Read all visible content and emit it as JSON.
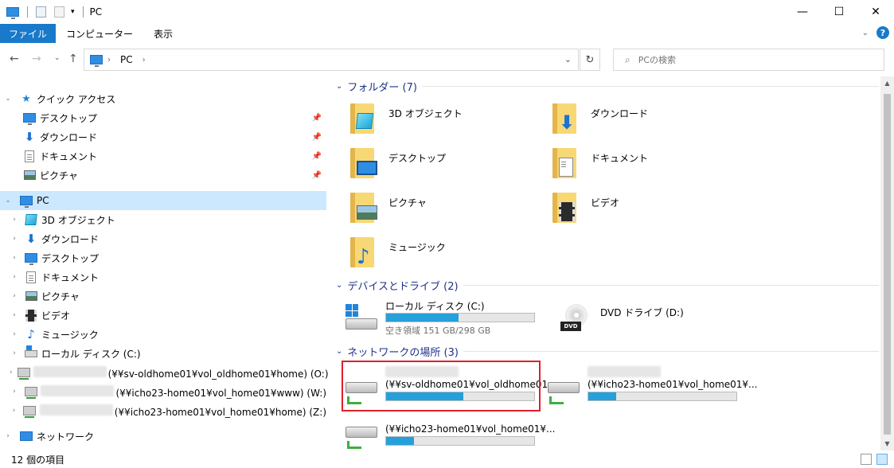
{
  "window": {
    "title": "PC",
    "buttons": {
      "minimize": "—",
      "maximize": "☐",
      "close": "✕"
    }
  },
  "ribbon": {
    "tabs": [
      "ファイル",
      "コンピューター",
      "表示"
    ],
    "help": "?"
  },
  "address": {
    "crumbs": [
      "PC"
    ],
    "search_placeholder": "PCの検索"
  },
  "nav": {
    "quick_access": {
      "label": "クイック アクセス",
      "items": [
        {
          "label": "デスクトップ",
          "icon": "desktop-icon"
        },
        {
          "label": "ダウンロード",
          "icon": "download-icon"
        },
        {
          "label": "ドキュメント",
          "icon": "document-icon"
        },
        {
          "label": "ピクチャ",
          "icon": "picture-icon"
        }
      ]
    },
    "pc": {
      "label": "PC",
      "items": [
        {
          "label": "3D オブジェクト",
          "icon": "3d-objects-icon"
        },
        {
          "label": "ダウンロード",
          "icon": "download-icon"
        },
        {
          "label": "デスクトップ",
          "icon": "desktop-icon"
        },
        {
          "label": "ドキュメント",
          "icon": "document-icon"
        },
        {
          "label": "ピクチャ",
          "icon": "picture-icon"
        },
        {
          "label": "ビデオ",
          "icon": "video-icon"
        },
        {
          "label": "ミュージック",
          "icon": "music-icon"
        },
        {
          "label": "ローカル ディスク (C:)",
          "icon": "local-disk-icon"
        },
        {
          "label": "(¥¥sv-oldhome01¥vol_oldhome01¥home) (O:)",
          "icon": "network-drive-icon"
        },
        {
          "label": "(¥¥icho23-home01¥vol_home01¥www) (W:)",
          "icon": "network-drive-icon"
        },
        {
          "label": "(¥¥icho23-home01¥vol_home01¥home) (Z:)",
          "icon": "network-drive-icon"
        }
      ]
    },
    "network": {
      "label": "ネットワーク"
    }
  },
  "content": {
    "folders_header": "フォルダー (7)",
    "folders": [
      {
        "label": "3D オブジェクト",
        "icon": "3d-objects-icon"
      },
      {
        "label": "ダウンロード",
        "icon": "download-icon"
      },
      {
        "label": "デスクトップ",
        "icon": "desktop-icon"
      },
      {
        "label": "ドキュメント",
        "icon": "document-icon"
      },
      {
        "label": "ピクチャ",
        "icon": "picture-icon"
      },
      {
        "label": "ビデオ",
        "icon": "video-icon"
      },
      {
        "label": "ミュージック",
        "icon": "music-icon"
      }
    ],
    "devices_header": "デバイスとドライブ (2)",
    "devices": [
      {
        "label": "ローカル ディスク (C:)",
        "free": "空き領域 151 GB/298 GB",
        "used_fraction": 0.49
      },
      {
        "label": "DVD ドライブ (D:)",
        "dvd_tag": "DVD"
      }
    ],
    "network_header": "ネットワークの場所 (3)",
    "network": [
      {
        "label": "(¥¥sv-oldhome01¥vol_oldhome01...",
        "used_fraction": 0.52
      },
      {
        "label": "(¥¥icho23-home01¥vol_home01¥...",
        "used_fraction": 0.19
      },
      {
        "label": "(¥¥icho23-home01¥vol_home01¥...",
        "used_fraction": 0.19
      }
    ]
  },
  "status": {
    "count": "12 個の項目"
  }
}
